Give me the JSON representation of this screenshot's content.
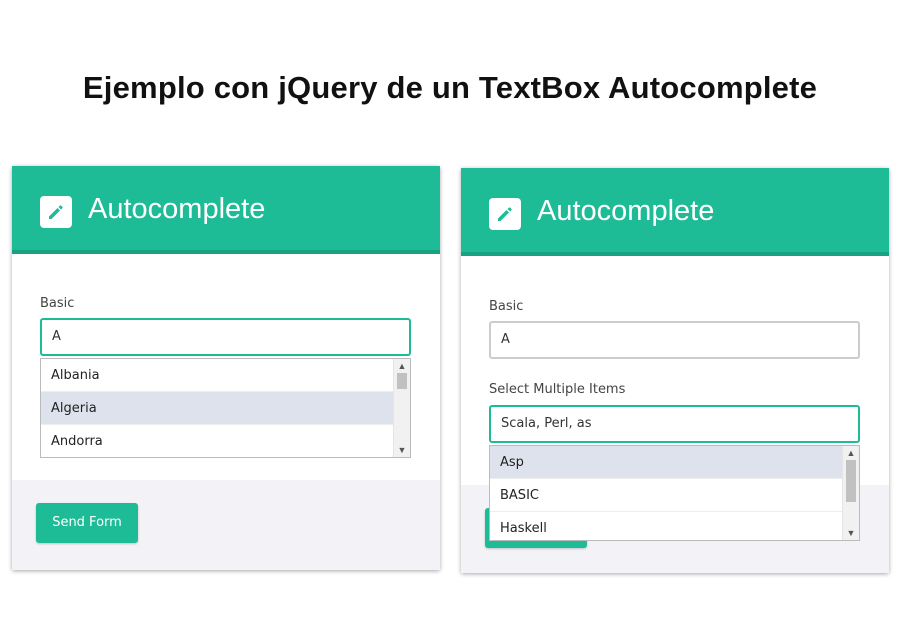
{
  "page": {
    "title": "Ejemplo con jQuery de un TextBox Autocomplete"
  },
  "colors": {
    "accent": "#1dbb96",
    "header_border": "#18a282",
    "highlight": "#dee2ec",
    "footer_bg": "#f3f3f7"
  },
  "left_card": {
    "header_title": "Autocomplete",
    "header_icon": "pencil-icon",
    "basic_label": "Basic",
    "basic_value": "A",
    "dropdown_items": [
      "Albania",
      "Algeria",
      "Andorra"
    ],
    "highlighted_item": "Algeria",
    "submit_label": "Send Form"
  },
  "right_card": {
    "header_title": "Autocomplete",
    "header_icon": "pencil-icon",
    "basic_label": "Basic",
    "basic_value": "A",
    "multi_label": "Select Multiple Items",
    "multi_value": "Scala, Perl, as",
    "dropdown_items": [
      "Asp",
      "BASIC",
      "Haskell"
    ],
    "highlighted_item": "Asp"
  }
}
